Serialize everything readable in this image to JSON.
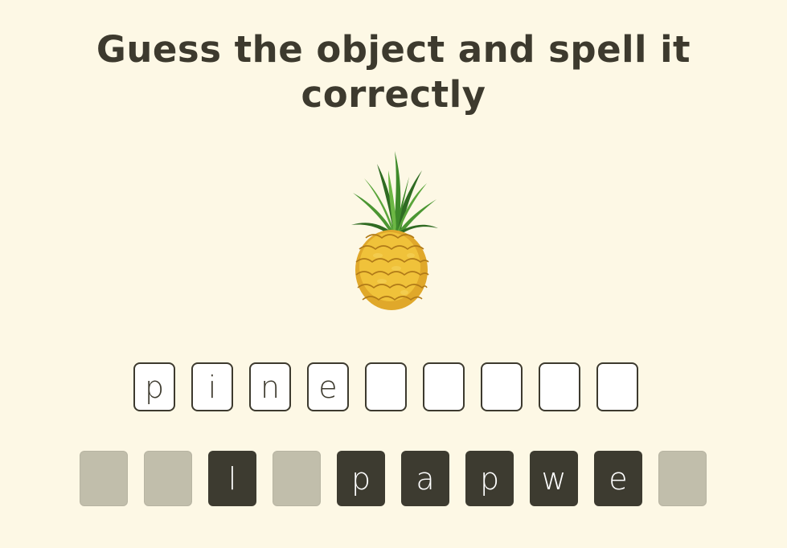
{
  "header": {
    "title": "Guess the object and spell it correctly"
  },
  "puzzle": {
    "image_icon": "pineapple-icon"
  },
  "answer": {
    "slots": [
      "p",
      "i",
      "n",
      "e",
      "",
      "",
      "",
      "",
      ""
    ]
  },
  "letter_pool": {
    "tiles": [
      {
        "letter": "",
        "used": true
      },
      {
        "letter": "",
        "used": true
      },
      {
        "letter": "l",
        "used": false
      },
      {
        "letter": "",
        "used": true
      },
      {
        "letter": "p",
        "used": false
      },
      {
        "letter": "a",
        "used": false
      },
      {
        "letter": "p",
        "used": false
      },
      {
        "letter": "w",
        "used": false
      },
      {
        "letter": "e",
        "used": false
      },
      {
        "letter": "",
        "used": true
      }
    ]
  },
  "colors": {
    "background": "#fdf8e5",
    "text": "#3d3a2e",
    "tile_active": "#3d3b30",
    "tile_used": "#c1beab"
  }
}
